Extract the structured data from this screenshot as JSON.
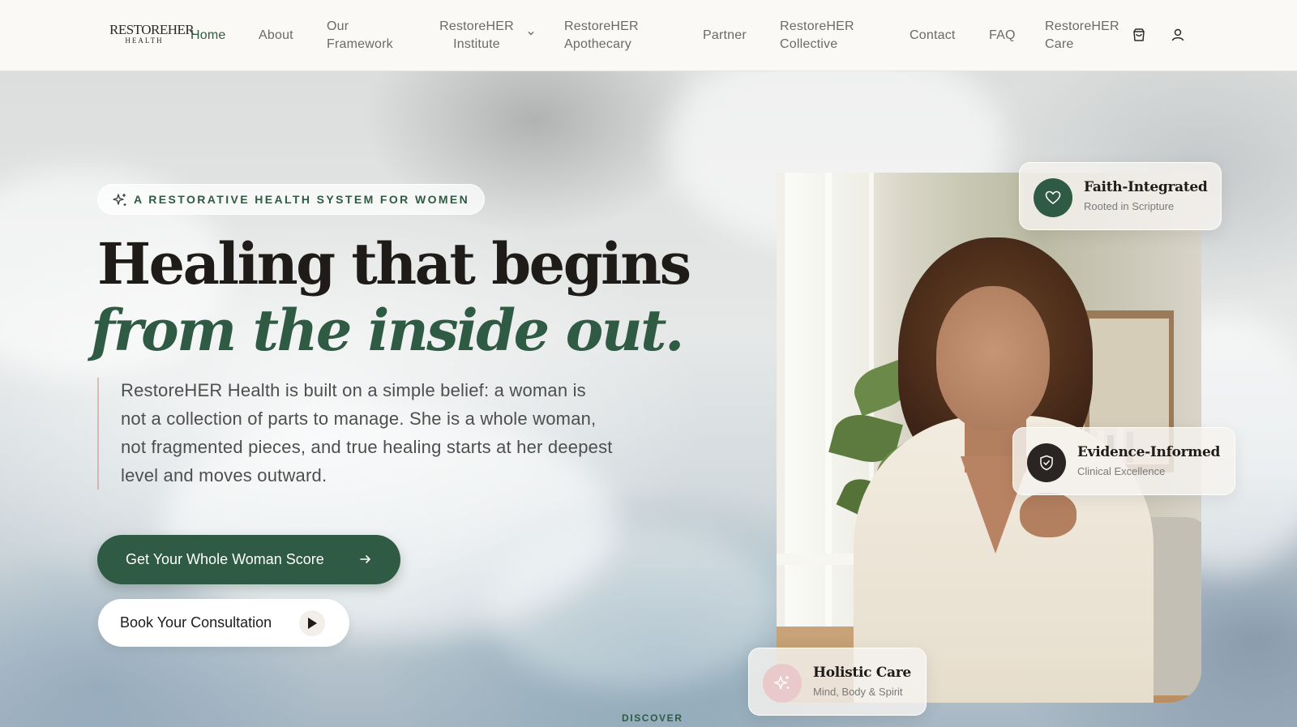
{
  "brand": {
    "logo_line1": "RESTOREHER",
    "logo_line2": "HEALTH"
  },
  "nav": {
    "home": "Home",
    "about": "About",
    "framework_1": "Our",
    "framework_2": "Framework",
    "institute_1": "RestoreHER",
    "institute_2": "Institute",
    "apothecary_1": "RestoreHER",
    "apothecary_2": "Apothecary",
    "partner": "Partner",
    "collective_1": "RestoreHER",
    "collective_2": "Collective",
    "contact": "Contact",
    "faq": "FAQ",
    "care_1": "RestoreHER",
    "care_2": "Care",
    "cart_icon": "shopping-bag-icon",
    "account_icon": "user-icon"
  },
  "hero": {
    "badge": "A RESTORATIVE HEALTH SYSTEM FOR WOMEN",
    "headline_1": "Healing that begins",
    "headline_2": "from the inside out.",
    "lead": "RestoreHER Health is built on a simple belief: a woman is not a collection of parts to manage. She is a whole woman, not fragmented pieces, and true healing starts at her deepest level and moves outward.",
    "cta_primary": "Get Your Whole Woman Score",
    "cta_secondary": "Book Your Consultation",
    "discover": "DISCOVER"
  },
  "features": [
    {
      "title": "Faith-Integrated",
      "subtitle": "Rooted in Scripture",
      "icon": "heart-icon"
    },
    {
      "title": "Evidence-Informed",
      "subtitle": "Clinical Excellence",
      "icon": "shield-check-icon"
    },
    {
      "title": "Holistic Care",
      "subtitle": "Mind, Body & Spirit",
      "icon": "sparkle-icon"
    }
  ],
  "colors": {
    "primary": "#2f5a44",
    "text_dark": "#1e1b18",
    "accent_pink": "#e9c9c9"
  }
}
